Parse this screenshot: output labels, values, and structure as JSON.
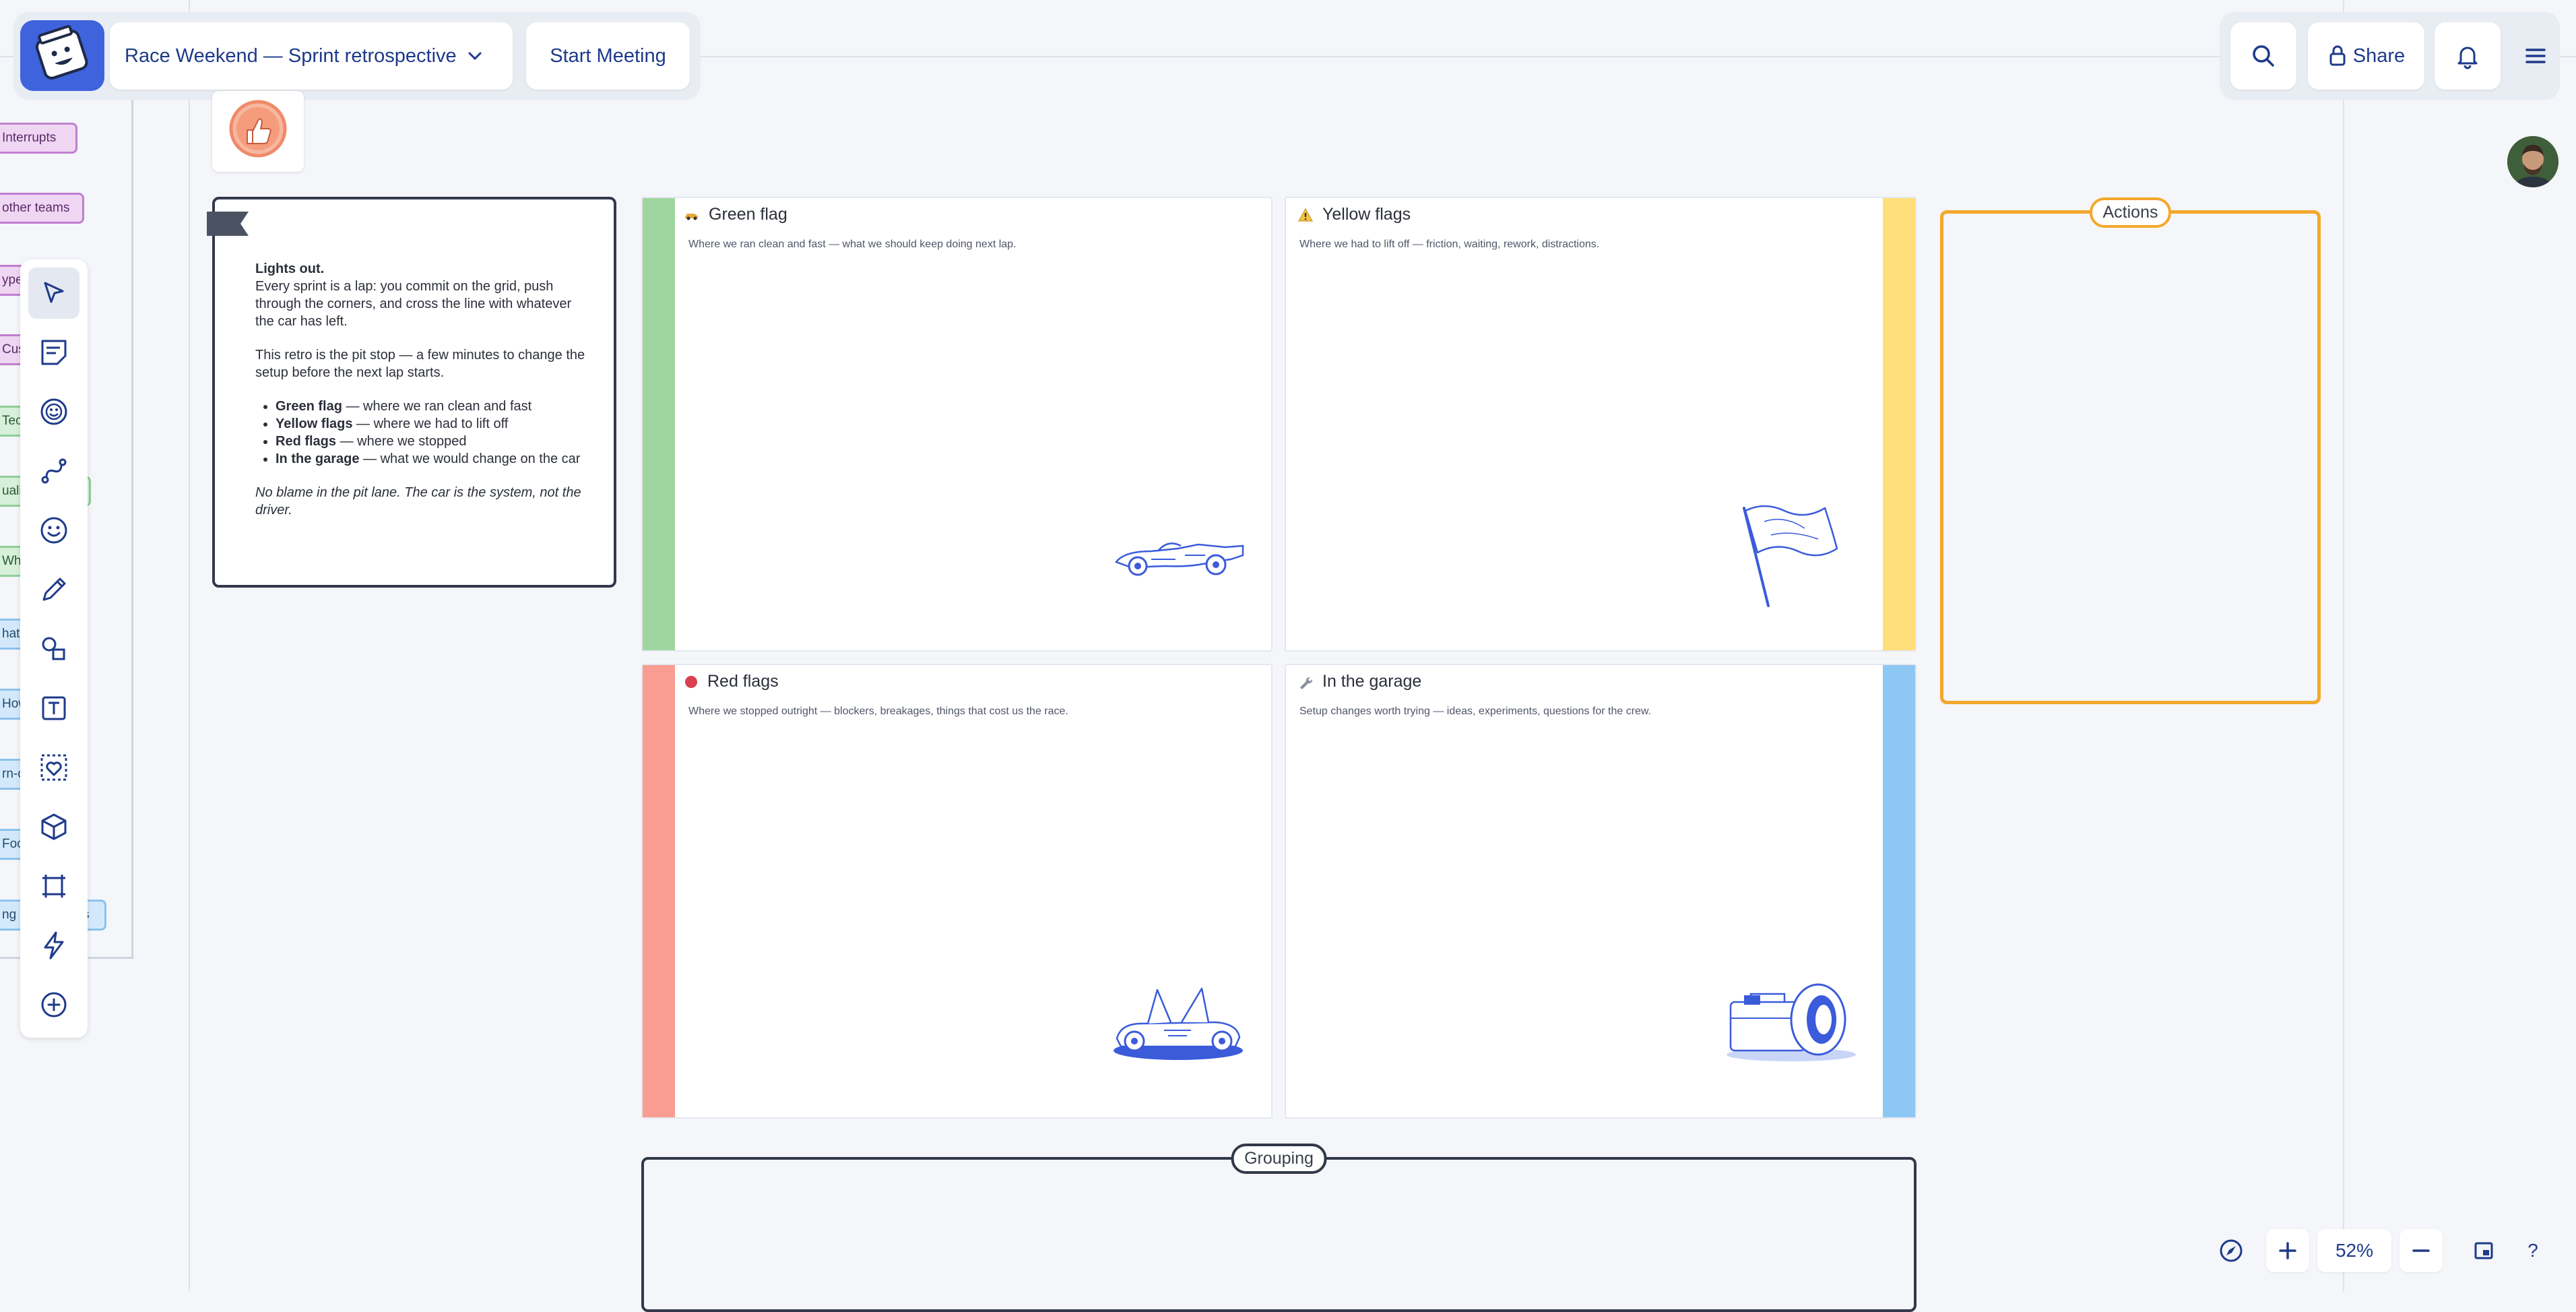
{
  "header": {
    "board_title": "Race Weekend — Sprint retrospective",
    "start_meeting_label": "Start Meeting",
    "share_label": "Share"
  },
  "left_tags": [
    {
      "label": "Interrupts",
      "color": "purple"
    },
    {
      "label": "other teams",
      "color": "purple"
    },
    {
      "label": "ype",
      "color": "purple"
    },
    {
      "label": "Cus",
      "color": "purple"
    },
    {
      "label": "Tec",
      "color": "green"
    },
    {
      "label": "uali",
      "color": "green"
    },
    {
      "label": "Wha",
      "color": "green"
    },
    {
      "label": "hat",
      "color": "blue"
    },
    {
      "label": "How",
      "color": "blue"
    },
    {
      "label": "rn-o",
      "color": "blue"
    },
    {
      "label": "Foc",
      "color": "blue"
    },
    {
      "label": "ng &",
      "color": "blue"
    },
    {
      "label": "s",
      "color": "blue"
    }
  ],
  "toolbar": {
    "tools": [
      "select-cursor-icon",
      "sticky-note-icon",
      "sticker-icon",
      "connector-icon",
      "emoji-icon",
      "pen-icon",
      "shapes-icon",
      "text-icon",
      "template-icon",
      "cube-icon",
      "frame-icon",
      "lightning-icon",
      "add-icon"
    ],
    "active": "select-cursor-icon"
  },
  "intro": {
    "heading": "Lights out.",
    "p1": "Every sprint is a lap: you commit on the grid, push through the corners, and cross the line with whatever the car has left.",
    "p2": "This retro is the pit stop — a few minutes to change the setup before the next lap starts.",
    "bullets": [
      {
        "bold": "Green flag",
        "rest": " — where we ran clean and fast"
      },
      {
        "bold": "Yellow flags",
        "rest": " — where we had to lift off"
      },
      {
        "bold": "Red flags",
        "rest": " — where we stopped"
      },
      {
        "bold": "In the garage",
        "rest": " — what we would change on the car"
      }
    ],
    "note": "No blame in the pit lane. The car is the system, not the driver."
  },
  "columns": [
    {
      "title": "Green flag",
      "icon": "race-car-emoji",
      "desc": "Where we ran clean and fast — what we should keep doing next lap.",
      "accent": "#9fd6a0"
    },
    {
      "title": "Yellow flags",
      "icon": "warning-emoji",
      "desc": "Where we had to lift off — friction, waiting, rework, distractions.",
      "accent": "#ffdf7a"
    },
    {
      "title": "Red flags",
      "icon": "red-dot",
      "desc": "Where we stopped outright — blockers, breakages, things that cost us the race.",
      "accent": "#f99d92"
    },
    {
      "title": "In the garage",
      "icon": "wrench-emoji",
      "desc": "Setup changes worth trying — ideas, experiments, questions for the crew.",
      "accent": "#8dc8f4"
    }
  ],
  "actions_label": "Actions",
  "grouping_label": "Grouping",
  "zoom": {
    "level": "52%",
    "help": "?"
  }
}
